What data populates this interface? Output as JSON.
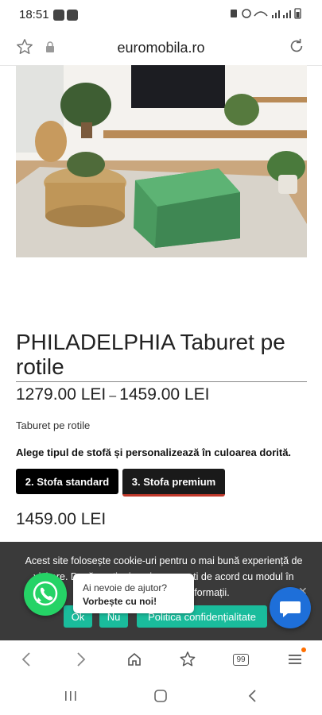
{
  "status_bar": {
    "time": "18:51"
  },
  "browser": {
    "url": "euromobila.ro",
    "tab_count": "99"
  },
  "product": {
    "title": "PHILADELPHIA Taburet pe rotile",
    "price_min": "1279.00 LEI",
    "price_separator": "–",
    "price_max": "1459.00 LEI",
    "subtitle": "Taburet pe rotile",
    "instruction": "Alege tipul de stofă și personalizează în culoarea dorită.",
    "options": [
      {
        "label": "2. Stofa standard",
        "selected": false
      },
      {
        "label": "3. Stofa premium",
        "selected": true
      }
    ],
    "selected_price": "1459.00 LEI"
  },
  "cookie_banner": {
    "message": "Acest site folosește cookie-uri pentru o mai bună experiență de vizitare. Dacă continui navigarea, ești de acord cu modul în care folosim aceste informații.",
    "ok_label": "Ok",
    "no_label": "Nu",
    "policy_label": "Politica confidențialitate"
  },
  "whatsapp": {
    "line1": "Ai nevoie de ajutor?",
    "line2": "Vorbește cu noi!"
  },
  "colors": {
    "accent": "#1abc9c",
    "whatsapp": "#25d366",
    "chat": "#1e6fd9",
    "premium_border": "#c0392b"
  }
}
